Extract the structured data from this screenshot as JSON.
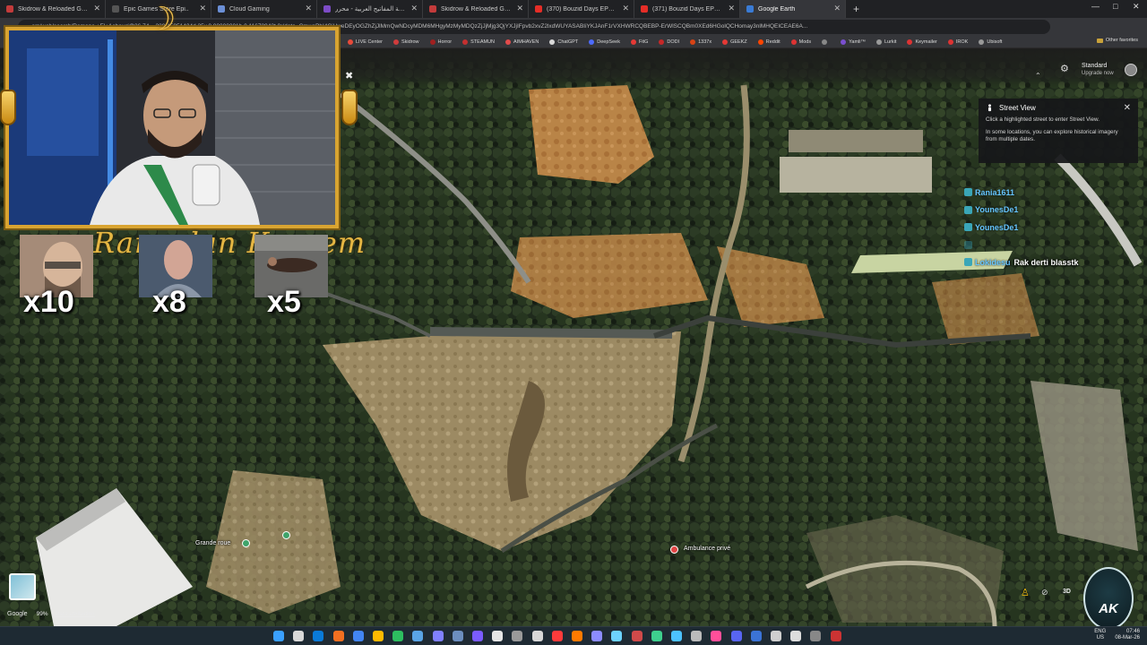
{
  "browser": {
    "tabs": [
      {
        "title": "Skidrow & Reloaded Games - Do",
        "color": "#c33b3b",
        "active": false
      },
      {
        "title": "Epic Games Store Epi..",
        "color": "#555555",
        "active": false
      },
      {
        "title": "Cloud Gaming",
        "color": "#6b8fd6",
        "active": false
      },
      {
        "title": "لوحة المفاتيح العربية - محرر Yamli",
        "color": "#7d4cc6",
        "active": false
      },
      {
        "title": "Skidrow & Reloaded Games - Do",
        "color": "#c33b3b",
        "active": false
      },
      {
        "title": "(370) Bouzid Days EP12 analyses",
        "color": "#e52d27",
        "active": false
      },
      {
        "title": "(371) Bouzid Days EP09 Docteur",
        "color": "#e52d27",
        "active": false
      },
      {
        "title": "Google Earth",
        "color": "#3a7bd5",
        "active": true
      }
    ],
    "address_visible": "...om/web/search/Romane,+El+Achour/@36.74...,339.45951424d,35y,0.00000001h,0.11678943t,0r/data=CmwaPhI4CiUweDEyOGZhZjJlMmQwNDcyMDM6MHgyMzMyMDQzZjJjMjg3QjYXJjIFpvb2xvZ2lxdWUYASABIiYKJAnF1rVXHWRCQBEBP-ErWlSCQBm0XEd6HGolQCHomay3nlMHQEICEAE6A...",
    "bookmarks": [
      {
        "label": "LIVE Center",
        "color": "#e84a3a"
      },
      {
        "label": "Skidrow",
        "color": "#d03c3c"
      },
      {
        "label": "Horror",
        "color": "#a02020"
      },
      {
        "label": "STEAMUN",
        "color": "#c53030"
      },
      {
        "label": "AIMHAVEN",
        "color": "#e24b4b"
      },
      {
        "label": "ChatGPT",
        "color": "#d9d9d9"
      },
      {
        "label": "DeepSeek",
        "color": "#4d6bfe"
      },
      {
        "label": "FitG",
        "color": "#e53935"
      },
      {
        "label": "DODI",
        "color": "#c62828"
      },
      {
        "label": "1337x",
        "color": "#d84315"
      },
      {
        "label": "GEEKZ",
        "color": "#e53935"
      },
      {
        "label": "Reddit",
        "color": "#ff4500"
      },
      {
        "label": "Mods",
        "color": "#d33"
      },
      {
        "label": "",
        "color": "#888888"
      },
      {
        "label": "Yamli™",
        "color": "#7b4fd0"
      },
      {
        "label": "Lurkit",
        "color": "#9a9a9a"
      },
      {
        "label": "Keymailer",
        "color": "#d33"
      },
      {
        "label": "IROK",
        "color": "#d33"
      },
      {
        "label": "Ubisoft",
        "color": "#999"
      }
    ],
    "other_favorites": "Other favorites"
  },
  "earth": {
    "plan_label": "Standard",
    "upgrade_label": "Upgrade now",
    "street_view": {
      "title": "Street View",
      "line1": "Click a highlighted street to enter Street View.",
      "line2": "In some locations, you can explore historical imagery from multiple dates."
    },
    "map_labels": [
      {
        "text": "Grande roue",
        "pin_color": "#3fa46a"
      },
      {
        "text": "Ambulance privé",
        "pin_color": "#e04545"
      }
    ],
    "footer": {
      "google": "Google",
      "zoom_pct": "99%",
      "attribution": "Data attribution"
    },
    "btn_3d": "3D"
  },
  "chat": [
    {
      "user": "Rania1611",
      "message": "",
      "faint": false
    },
    {
      "user": "YounesDe1",
      "message": "",
      "faint": false
    },
    {
      "user": "YounesDe1",
      "message": "",
      "faint": false
    },
    {
      "user": "",
      "message": "",
      "faint": true
    },
    {
      "user": "Lokidesu",
      "message": "Rak derti blasstk",
      "faint": false
    }
  ],
  "overlay": {
    "ramadan": "Ramadan Kareem",
    "counters": [
      {
        "value": "x10"
      },
      {
        "value": "x8"
      },
      {
        "value": "x5"
      }
    ],
    "logo": "AK"
  },
  "taskbar": {
    "lang1": "ENG",
    "lang2": "US",
    "time": "07:46",
    "date": "08-Mar-26"
  }
}
